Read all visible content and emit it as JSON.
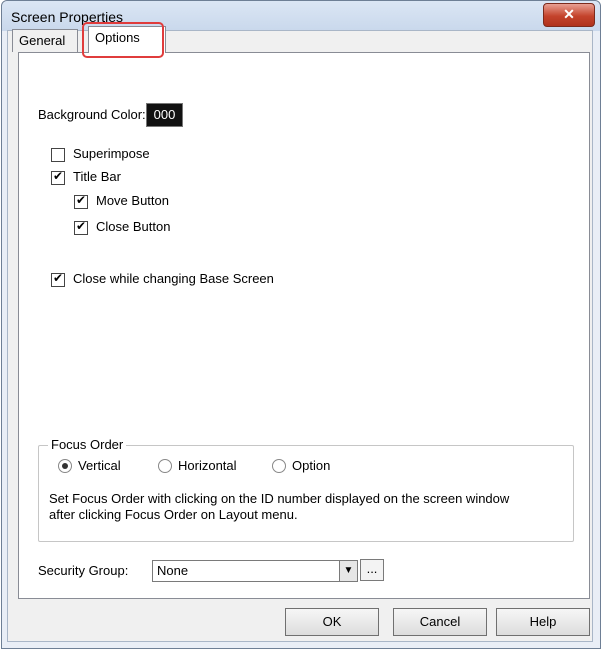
{
  "window": {
    "title": "Screen Properties",
    "close_glyph": "✕"
  },
  "tabs": [
    {
      "label": "General"
    },
    {
      "label": "Options"
    }
  ],
  "options": {
    "background_color_label": "Background Color:",
    "background_color_value": "000",
    "superimpose": {
      "label": "Superimpose",
      "checked": false
    },
    "title_bar": {
      "label": "Title Bar",
      "checked": true
    },
    "move_button": {
      "label": "Move Button",
      "checked": true
    },
    "close_button": {
      "label": "Close Button",
      "checked": true
    },
    "close_while_changing": {
      "label": "Close while changing Base Screen",
      "checked": true
    }
  },
  "focus_order": {
    "legend": "Focus Order",
    "vertical": "Vertical",
    "horizontal": "Horizontal",
    "option": "Option",
    "selected": "Vertical",
    "note_line1": "Set Focus Order with clicking on the ID number displayed on the screen window",
    "note_line2": "after clicking Focus Order on Layout menu."
  },
  "security_group": {
    "label": "Security Group:",
    "value": "None",
    "browse": "..."
  },
  "buttons": {
    "ok": "OK",
    "cancel": "Cancel",
    "help": "Help"
  },
  "colors": {
    "highlight": "#e03c3c",
    "title_gradient": "#c9d8ec",
    "close_button": "#c4432c"
  }
}
